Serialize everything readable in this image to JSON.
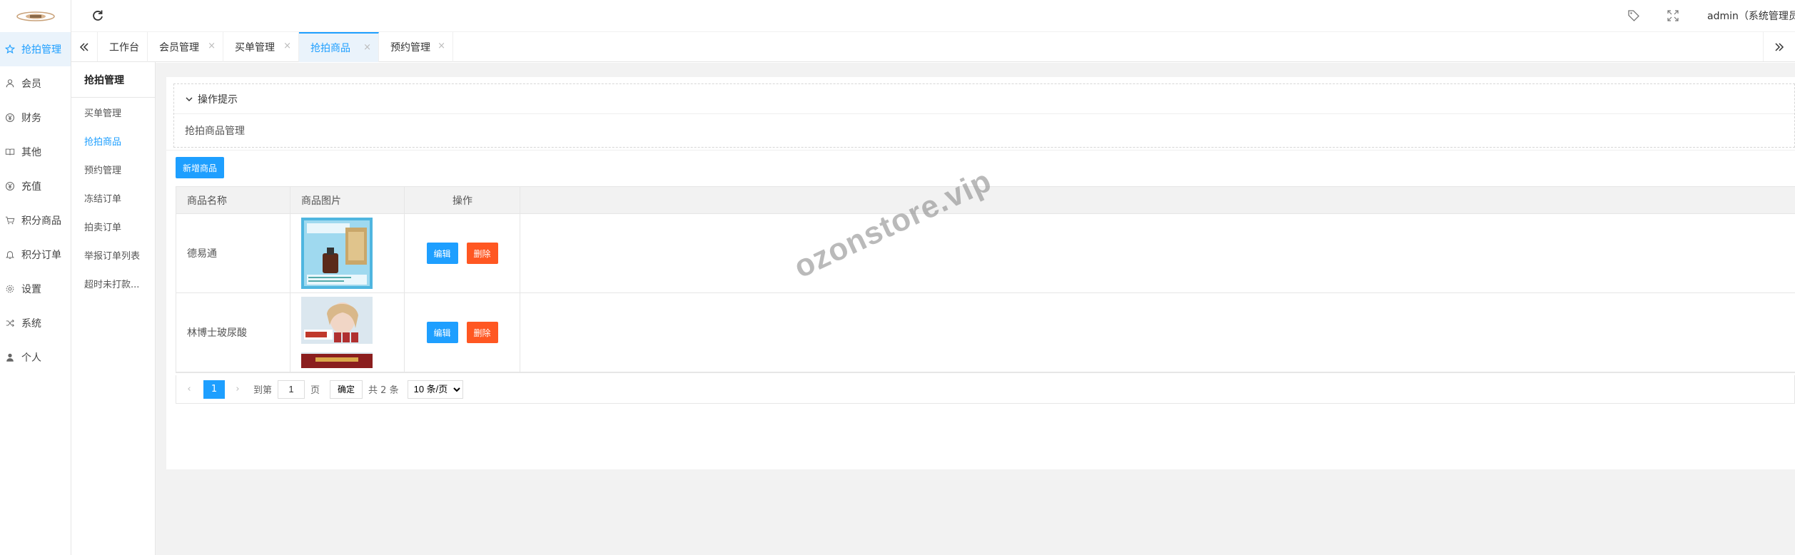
{
  "header": {
    "user_label": "admin（系统管理员"
  },
  "leftnav": {
    "items": [
      {
        "label": "抢拍管理",
        "icon": "star-icon",
        "active": true
      },
      {
        "label": "会员",
        "icon": "user-icon"
      },
      {
        "label": "财务",
        "icon": "yen-icon"
      },
      {
        "label": "其他",
        "icon": "book-icon"
      },
      {
        "label": "充值",
        "icon": "yen-circle-icon"
      },
      {
        "label": "积分商品",
        "icon": "cart-icon"
      },
      {
        "label": "积分订单",
        "icon": "bell-icon"
      },
      {
        "label": "设置",
        "icon": "gear-icon"
      },
      {
        "label": "系统",
        "icon": "shuffle-icon"
      },
      {
        "label": "个人",
        "icon": "person-icon"
      }
    ]
  },
  "tabs": {
    "items": [
      {
        "label": "工作台",
        "closable": false
      },
      {
        "label": "会员管理",
        "closable": true
      },
      {
        "label": "买单管理",
        "closable": true
      },
      {
        "label": "抢拍商品",
        "closable": true,
        "active": true
      },
      {
        "label": "预约管理",
        "closable": true
      }
    ],
    "close_glyph": "×"
  },
  "subnav": {
    "title": "抢拍管理",
    "items": [
      {
        "label": "买单管理"
      },
      {
        "label": "抢拍商品",
        "active": true
      },
      {
        "label": "预约管理"
      },
      {
        "label": "冻结订单"
      },
      {
        "label": "拍卖订单"
      },
      {
        "label": "举报订单列表"
      },
      {
        "label": "超时未打款..."
      }
    ]
  },
  "tips": {
    "title": "操作提示",
    "body": "抢拍商品管理"
  },
  "toolbar": {
    "add_label": "新增商品"
  },
  "table": {
    "columns": [
      "商品名称",
      "商品图片",
      "操作"
    ],
    "rows": [
      {
        "name": "德易通",
        "edit": "编辑",
        "delete": "删除"
      },
      {
        "name": "林博士玻尿酸",
        "edit": "编辑",
        "delete": "删除"
      }
    ]
  },
  "pager": {
    "current_page": "1",
    "goto_label": "到第",
    "page_input": "1",
    "page_unit": "页",
    "go_label": "确定",
    "total_label": "共 2 条",
    "page_size": "10 条/页",
    "prev_glyph": "‹",
    "next_glyph": "›"
  },
  "watermark": "ozonstore.vip",
  "colors": {
    "primary": "#1e9fff",
    "danger": "#ff5722",
    "bg": "#f2f2f2"
  }
}
